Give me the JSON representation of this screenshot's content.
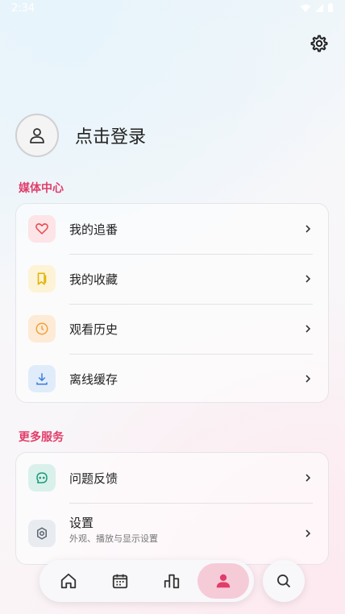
{
  "status": {
    "time": "2:34"
  },
  "profile": {
    "login_label": "点击登录"
  },
  "media_section": {
    "title": "媒体中心",
    "items": [
      {
        "label": "我的追番",
        "icon": "heart-icon",
        "color": "#e5484d"
      },
      {
        "label": "我的收藏",
        "icon": "bookmark-icon",
        "color": "#e0b400"
      },
      {
        "label": "观看历史",
        "icon": "clock-icon",
        "color": "#f0a13a"
      },
      {
        "label": "离线缓存",
        "icon": "download-icon",
        "color": "#3b7ddd"
      }
    ]
  },
  "more_section": {
    "title": "更多服务",
    "items": [
      {
        "label": "问题反馈",
        "icon": "chat-icon",
        "color": "#1f9a7a"
      },
      {
        "label": "设置",
        "sublabel": "外观、播放与显示设置",
        "icon": "gear-icon",
        "color": "#5a6470"
      }
    ]
  },
  "colors": {
    "accent": "#e13d6a",
    "nav_active_bg": "#f6cbd8"
  }
}
